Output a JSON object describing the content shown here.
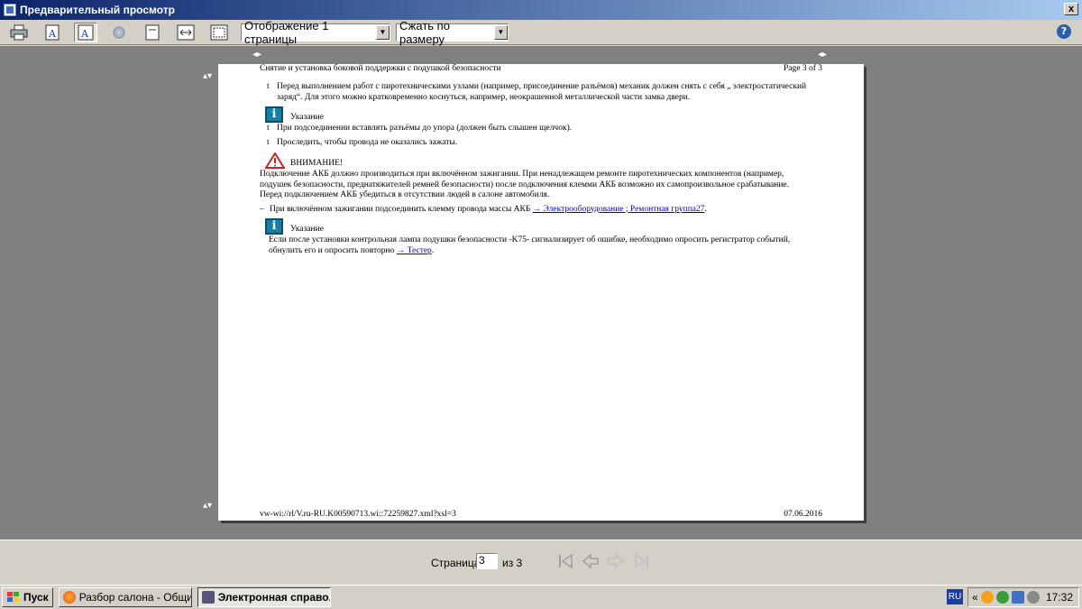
{
  "window": {
    "title": "Предварительный просмотр",
    "close_label": "x"
  },
  "toolbar": {
    "icons": [
      "printer-icon",
      "font-a-icon",
      "font-a-pressed-icon",
      "settings-gear-icon",
      "page-icon",
      "fit-width-icon",
      "fit-page-icon"
    ],
    "view_mode": "Отображение 1 страницы",
    "zoom_mode": "Сжать по размеру",
    "help_label": "?"
  },
  "page": {
    "header_title": "Снятие и установка боковой поддержки с подушкой безопасности",
    "header_page": "Page 3 of 3",
    "bullet_1": "Перед выполнением работ с пиротехническими узлами (например, присоединение разъёмов) механик должен снять с себя „ электростатический заряд“. Для этого можно кратковременно коснуться, например, неокрашенной металлической части замка двери.",
    "note_1_label": "Указание",
    "bullet_2": "При подсоединении вставлять разъёмы до упора (должен быть слышен щелчок).",
    "bullet_3": "Проследить, чтобы провода не оказались зажаты.",
    "warning_label": "ВНИМАНИЕ!",
    "warning_text": "Подключение АКБ должно производиться при включённом зажигании. При ненадлежащем ремонте пиротехнических компонентов (например, подушек безопасности, преднатяжителей ремней безопасности) после подключения клемми АКБ возможно их самопроизвольное срабатывание. Перед подключением АКБ убедиться в отсутствии людей в салоне автомобиля.",
    "step_text": "При включённом зажигании подсоединить клемму провода массы АКБ",
    "step_link": "→ Электрооборудование ; Ремонтная группа27",
    "step_end": ".",
    "note_2_label": "Указание",
    "note_2_text": "Если после установки контрольная лампа подушки безопасности -K75- сигнализирует об ошибке, необходимо опросить регистратор событий, обнулить его и опросить повторно",
    "note_2_link": "→ Тестер",
    "note_2_end": ".",
    "footer_url": "vw-wi://rl/V.ru-RU.K00590713.wi::72259827.xml?xsl=3",
    "footer_date": "07.06.2016",
    "bullet_char": "t",
    "dash_char": "–"
  },
  "navigation": {
    "page_label": "Страница",
    "current_page": "3",
    "of_label": "из 3"
  },
  "taskbar": {
    "start_label": "Пуск",
    "task_1": "Разбор салона - Общие...",
    "task_2": "Электронная справо...",
    "lang": "RU",
    "tray_chevron": "«",
    "clock": "17:32"
  }
}
